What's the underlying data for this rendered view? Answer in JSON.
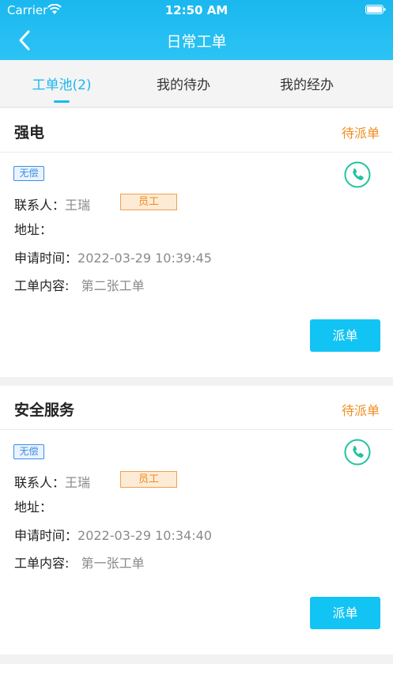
{
  "status_bar": {
    "carrier": "Carrier",
    "time": "12:50 AM"
  },
  "nav": {
    "title": "日常工单"
  },
  "tabs": [
    {
      "label": "工单池(2)"
    },
    {
      "label": "我的待办"
    },
    {
      "label": "我的经办"
    }
  ],
  "labels": {
    "contact": "联系人：",
    "address": "地址：",
    "apply_time": "申请时间：",
    "content": "工单内容:"
  },
  "orders": [
    {
      "title": "强电",
      "status": "待派单",
      "badge": "无偿",
      "contact_name": "王瑞",
      "role": "员工",
      "address": "",
      "apply_time": "2022-03-29 10:39:45",
      "content": "第二张工单",
      "action": "派单"
    },
    {
      "title": "安全服务",
      "status": "待派单",
      "badge": "无偿",
      "contact_name": "王瑞",
      "role": "员工",
      "address": "",
      "apply_time": "2022-03-29 10:34:40",
      "content": "第一张工单",
      "action": "派单"
    }
  ],
  "colors": {
    "header": "#1ab8ef",
    "accent": "#1ab8ef",
    "status": "#f08c1d",
    "button": "#12c4f3",
    "phone": "#1fc3a0"
  },
  "icons": [
    "wifi-icon",
    "battery-icon",
    "back-arrow-icon",
    "phone-icon"
  ]
}
